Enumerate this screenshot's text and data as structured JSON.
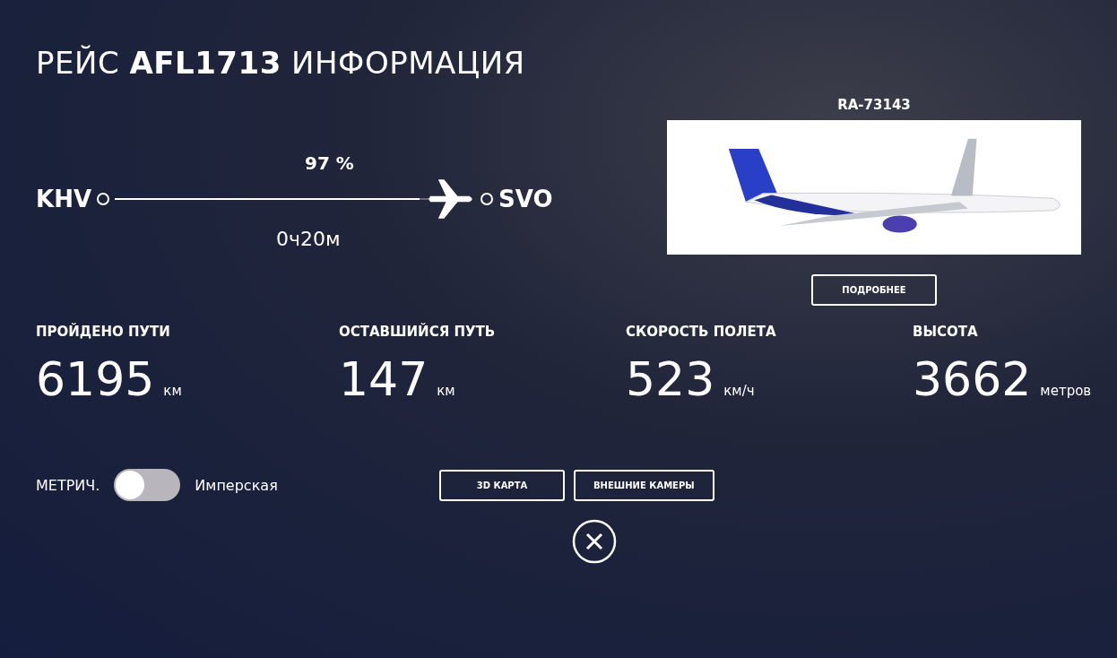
{
  "title": "РЕЙС **AFL1713** ИНФОРМАЦИЯ",
  "route": {
    "origin": "KHV",
    "destination": "SVO",
    "percent": "97 %",
    "level": 0.97,
    "remaining_time": "0ч20м"
  },
  "aircraft": {
    "registration": "RA-73143",
    "details_button": "ПОДРОБНЕЕ"
  },
  "stats": [
    {
      "label": "ПРОЙДЕНО ПУТИ",
      "value": "6195",
      "unit": "км"
    },
    {
      "label": "ОСТАВШИЙСЯ ПУТЬ",
      "value": "147",
      "unit": "км"
    },
    {
      "label": "СКОРОСТЬ ПОЛЕТА",
      "value": "523",
      "unit": "км/ч"
    },
    {
      "label": "ВЫСОТА",
      "value": "3662",
      "unit": "метров"
    }
  ],
  "units_toggle": {
    "left_label": "МЕТРИЧ.",
    "right_label": "Имперская",
    "on": false
  },
  "buttons": [
    "3D КАРТА",
    "ВНЕШНИЕ КАМЕРЫ"
  ]
}
